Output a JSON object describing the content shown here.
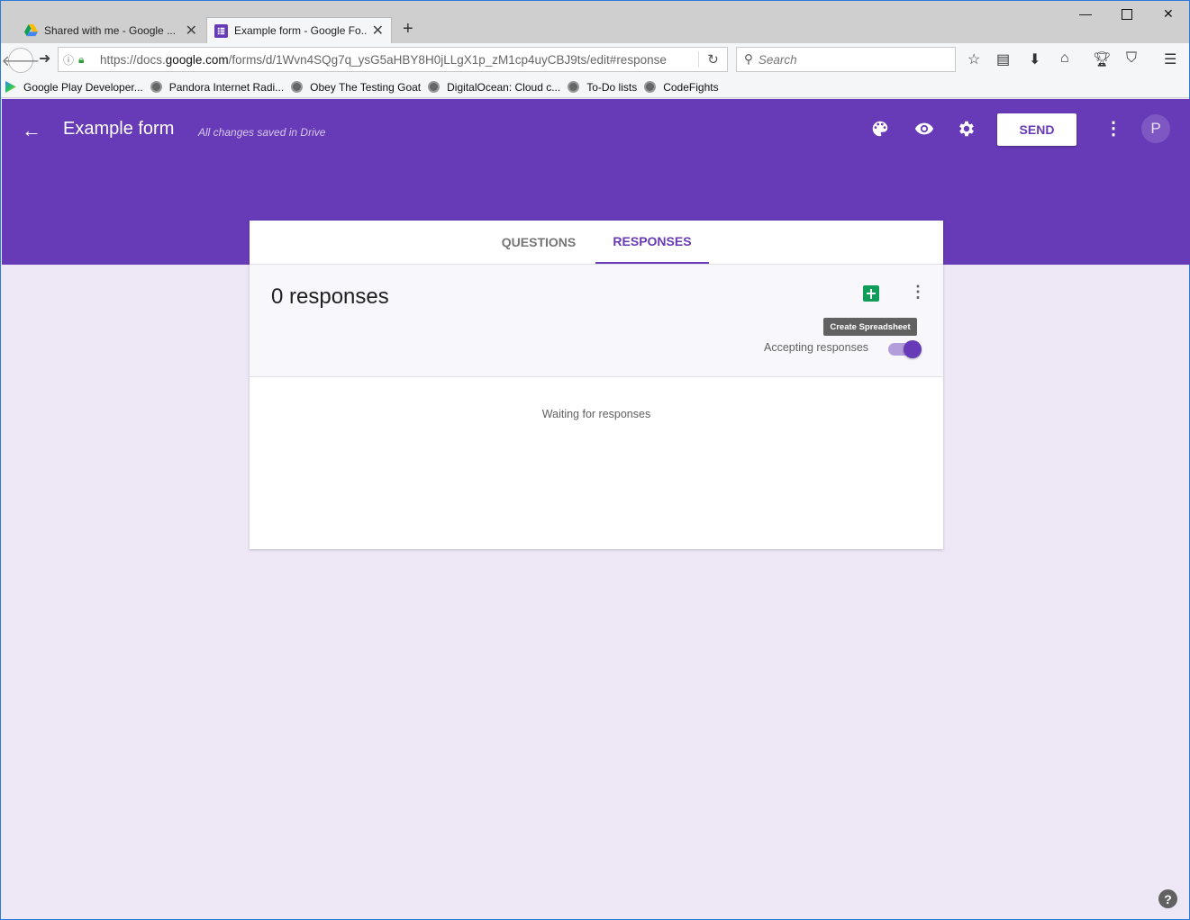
{
  "browser": {
    "tabs": [
      {
        "label": "Shared with me - Google ...",
        "close": "✕"
      },
      {
        "label": "Example form - Google Fo...",
        "close": "✕"
      }
    ],
    "new_tab": "+",
    "url_prefix": "https://docs.",
    "url_domain": "google.com",
    "url_rest": "/forms/d/1Wvn4SQg7q_ysG5aHBY8H0jLLgX1p_zM1cp4uyCBJ9ts/edit#response",
    "search_placeholder": "Search",
    "bookmarks": [
      "Google Play Developer...",
      "Pandora Internet Radi...",
      "Obey The Testing Goat",
      "DigitalOcean: Cloud c...",
      "To-Do lists",
      "CodeFights"
    ]
  },
  "header": {
    "title": "Example form",
    "saved_status": "All changes saved in Drive",
    "send_label": "SEND",
    "avatar_initial": "P",
    "accent_color": "#673ab7"
  },
  "card": {
    "tabs": [
      "QUESTIONS",
      "RESPONSES"
    ],
    "active_tab": "RESPONSES",
    "response_count": "0 responses",
    "tooltip": "Create Spreadsheet",
    "accepting_label": "Accepting responses",
    "accepting": true,
    "waiting_text": "Waiting for responses"
  },
  "help": "?"
}
